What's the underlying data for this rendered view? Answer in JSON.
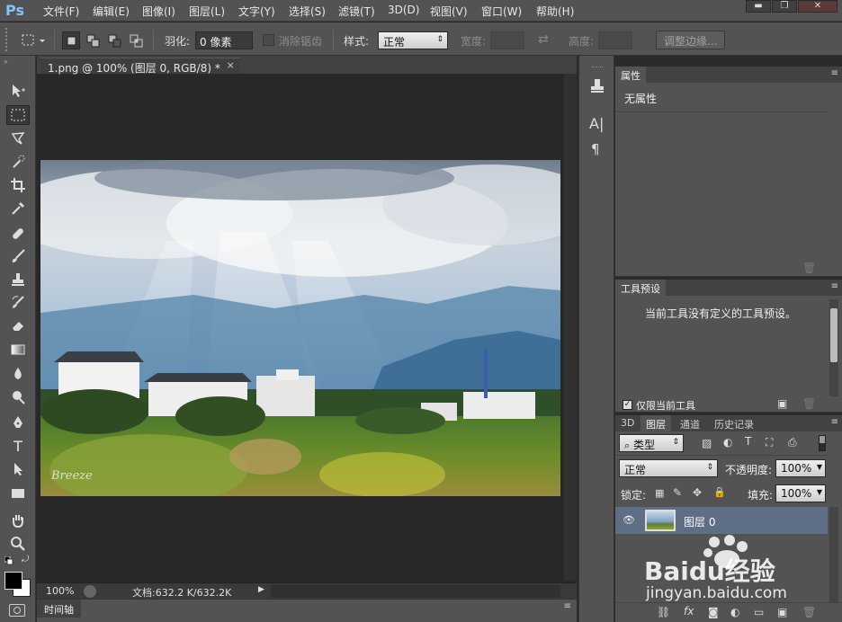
{
  "app": {
    "logo": "Ps"
  },
  "menu": [
    "文件(F)",
    "编辑(E)",
    "图像(I)",
    "图层(L)",
    "文字(Y)",
    "选择(S)",
    "滤镜(T)",
    "3D(D)",
    "视图(V)",
    "窗口(W)",
    "帮助(H)"
  ],
  "window_controls": {
    "minimize": "▬",
    "maximize": "❐",
    "close": "✕"
  },
  "options_bar": {
    "feather_label": "羽化:",
    "feather_value": "0 像素",
    "antialias_label": "消除锯齿",
    "style_label": "样式:",
    "style_value": "正常",
    "width_label": "宽度:",
    "height_label": "高度:",
    "refine_edge_button": "调整边缘..."
  },
  "document": {
    "tab_title": "1.png @ 100% (图层 0, RGB/8) *",
    "tab_close": "×",
    "zoom": "100%",
    "doc_info": "文档:632.2 K/632.2K",
    "watermark_text": "Breeze"
  },
  "timeline": {
    "label": "时间轴"
  },
  "properties_panel": {
    "tab": "属性",
    "body_text": "无属性"
  },
  "tool_presets_panel": {
    "tab": "工具预设",
    "body_text": "当前工具没有定义的工具预设。",
    "current_tool_only_label": "仅限当前工具",
    "current_tool_only_checked": true
  },
  "layers_panel": {
    "tabs": [
      "3D",
      "图层",
      "通道",
      "历史记录"
    ],
    "active_tab": "图层",
    "filter_kind": "类型",
    "blend_mode": "正常",
    "opacity_label": "不透明度:",
    "opacity_value": "100%",
    "lock_label": "锁定:",
    "fill_label": "填充:",
    "fill_value": "100%",
    "layers": [
      {
        "name": "图层 0",
        "visible": true
      }
    ]
  },
  "watermark": {
    "brand": "Baidu经验",
    "url": "jingyan.baidu.com"
  },
  "colors": {
    "accent_blue": "#7fc3ff",
    "selected_layer": "#5e6e85"
  }
}
